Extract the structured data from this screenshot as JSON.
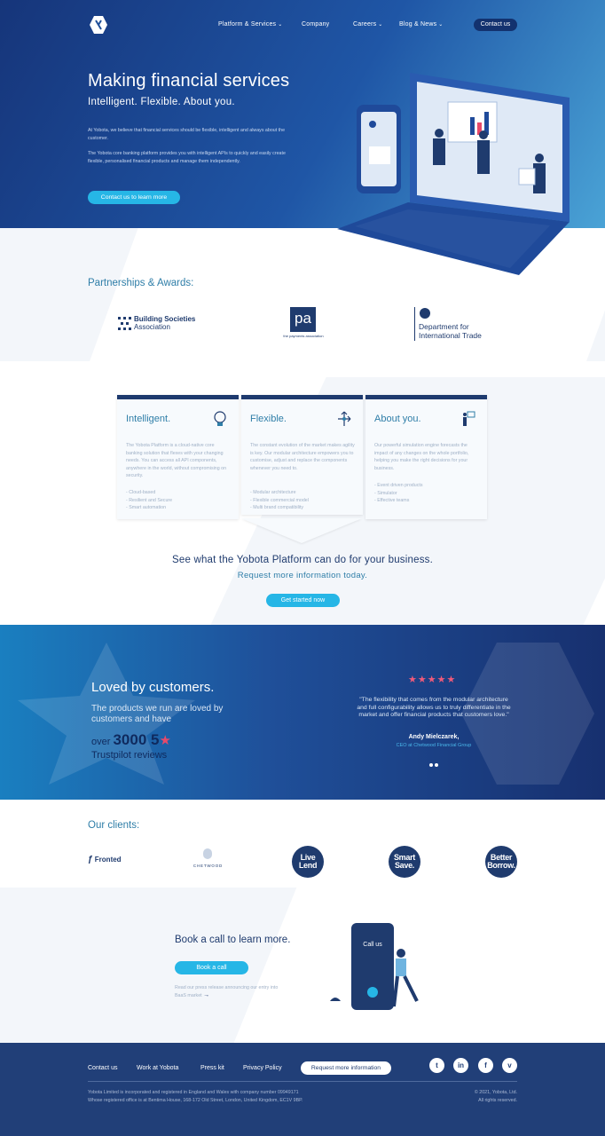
{
  "nav": {
    "items": [
      {
        "label": "Platform & Services",
        "has_dropdown": true
      },
      {
        "label": "Company",
        "has_dropdown": false
      },
      {
        "label": "Careers",
        "has_dropdown": true
      },
      {
        "label": "Blog & News",
        "has_dropdown": true
      }
    ],
    "contact": "Contact us"
  },
  "hero": {
    "title": "Making financial services",
    "subtitle": "Intelligent. Flexible. About you.",
    "p1": "At Yobota, we believe that financial services should be flexible, intelligent and always about the customer.",
    "p2": "The Yobota core banking platform provides you with intelligent APIs to quickly and easily create flexible, personalised financial products and manage them independently.",
    "cta": "Contact us to learn more"
  },
  "partners": {
    "title": "Partnerships & Awards:",
    "logos": [
      {
        "name": "Building Societies Association",
        "line1": "Building Societies",
        "line2": "Association"
      },
      {
        "name": "the payments association",
        "mark": "pa",
        "caption": "the payments association"
      },
      {
        "name": "Department for International Trade",
        "line1": "Department for",
        "line2": "International Trade"
      }
    ]
  },
  "features": [
    {
      "title": "Intelligent.",
      "icon": "lightbulb-icon",
      "desc": "The Yobota Platform is a cloud-native core banking solution that flexes with your changing needs. You can access all API components, anywhere in the world, without compromising on security.",
      "bullets": [
        "- Cloud-based",
        "- Resilient and Secure",
        "- Smart automation"
      ]
    },
    {
      "title": "Flexible.",
      "icon": "arrows-icon",
      "desc": "The constant evolution of the market makes agility is key. Our modular architecture empowers you to customise, adjust and replace the components whenever you need to.",
      "bullets": [
        "- Modular architecture",
        "- Flexible commercial model",
        "- Multi brand compatibility"
      ]
    },
    {
      "title": "About you.",
      "icon": "presenter-icon",
      "desc": "Our powerful simulation engine forecasts the impact of any changes on the whole portfolio, helping you make the right decisions for your business.",
      "bullets": [
        "- Event driven products",
        "- Simulator",
        "- Effective teams"
      ]
    }
  ],
  "platform": {
    "headline": "See what the Yobota Platform can do for your business.",
    "request": "Request more information today.",
    "cta": "Get started now"
  },
  "loved": {
    "title": "Loved by customers.",
    "text": "The products we run are loved by customers and have",
    "over": "over",
    "count": "3000 5",
    "reviews": "Trustpilot reviews",
    "stars": "★★★★★",
    "quote": "\"The flexibility that comes from the modular architecture and full configurability allows us to truly differentiate in the market and offer financial products that customers love.\"",
    "author": "Andy Mielczarek,",
    "role": "CEO at Chetwood Financial Group"
  },
  "clients": {
    "title": "Our clients:",
    "logos": [
      "Fronted",
      "CHETWOOD",
      "Live Lend",
      "Smart Save.",
      "Better Borrow."
    ]
  },
  "book": {
    "title": "Book a call to learn more.",
    "cta": "Book a call",
    "press": "Read our press release announcing our entry into BaaS market",
    "phone_label": "Call us"
  },
  "footer": {
    "links": [
      "Contact us",
      "Work at Yobota",
      "Press kit",
      "Privacy Policy"
    ],
    "request": "Request more information",
    "social": [
      "twitter-icon",
      "linkedin-icon",
      "facebook-icon",
      "vimeo-icon"
    ],
    "legal1": "Yobota Limited is incorporated and registered in England and Wales with company number 09949171",
    "legal2": "Whose registered office is at Bentima House, 168-172 Old Street, London, United Kingdom, EC1V 9BP.",
    "copyright": "© 2021, Yobota, Ltd.",
    "rights": "All rights reserved."
  },
  "colors": {
    "navy": "#1f3b6e",
    "accent": "#26b6e6",
    "heading_blue": "#2f7ea8",
    "star_pink": "#f05a7a"
  }
}
